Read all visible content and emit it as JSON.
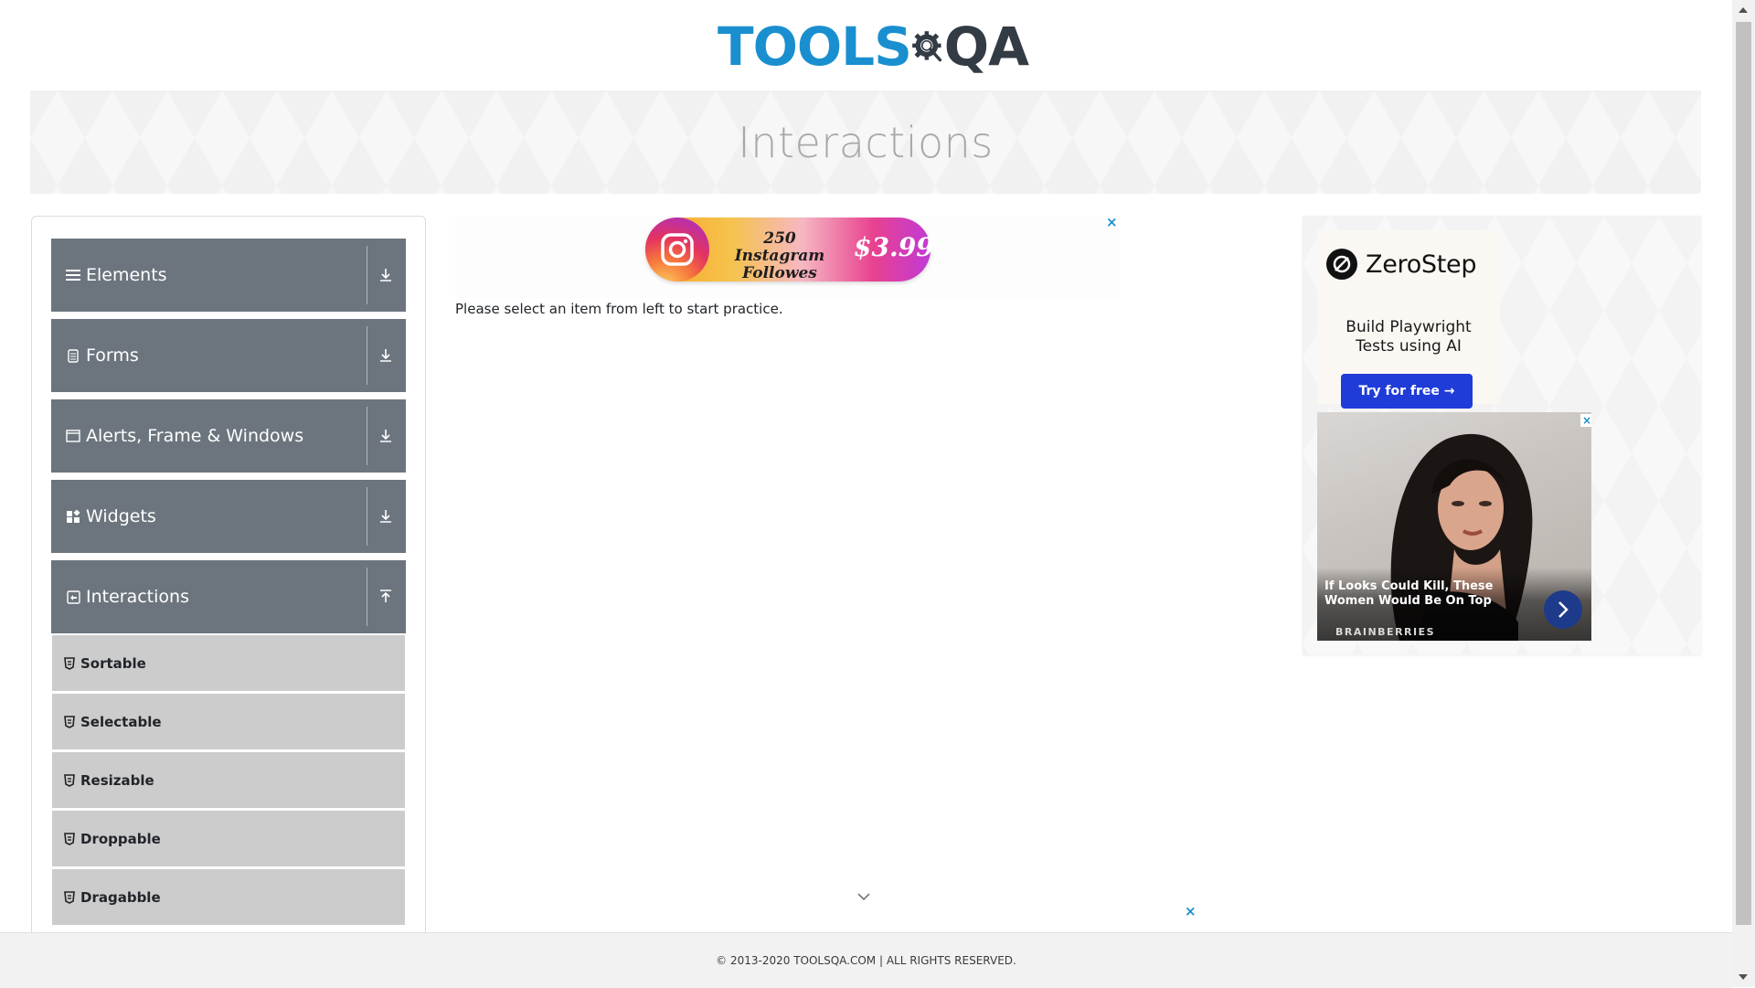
{
  "header": {
    "logo_tools": "TOOLS",
    "logo_qa": "QA",
    "banner_title": "Interactions"
  },
  "nav": {
    "groups": [
      {
        "label": "Elements",
        "icon": "hamburger-icon",
        "expanded": false
      },
      {
        "label": "Forms",
        "icon": "document-icon",
        "expanded": false
      },
      {
        "label": "Alerts, Frame & Windows",
        "icon": "window-icon",
        "expanded": false
      },
      {
        "label": "Widgets",
        "icon": "widgets-icon",
        "expanded": false
      },
      {
        "label": "Interactions",
        "icon": "interactions-icon",
        "expanded": true
      }
    ],
    "interactions_items": [
      {
        "label": "Sortable"
      },
      {
        "label": "Selectable"
      },
      {
        "label": "Resizable"
      },
      {
        "label": "Droppable"
      },
      {
        "label": "Dragabble"
      }
    ]
  },
  "main": {
    "practice_text": "Please select an item from left to start practice."
  },
  "ads": {
    "top": {
      "text": "250 Instagram Followes",
      "price": "$3.99",
      "close": "×"
    },
    "bottom_close": "×",
    "zerostep": {
      "brand": "ZeroStep",
      "tagline_line1": "Build Playwright",
      "tagline_line2": "Tests using AI",
      "cta": "Try for free →"
    },
    "brainberries": {
      "headline": "If Looks Could Kill, These Women Would Be On Top",
      "source": "BRAINBERRIES",
      "close": "×"
    }
  },
  "footer": {
    "text": "© 2013-2020 TOOLSQA.COM | ALL RIGHTS RESERVED."
  },
  "colors": {
    "brand_blue": "#1a8fd0",
    "nav_group_bg": "#6c757d",
    "nav_item_bg": "#cccccc",
    "cta_blue": "#1f3bd8"
  }
}
